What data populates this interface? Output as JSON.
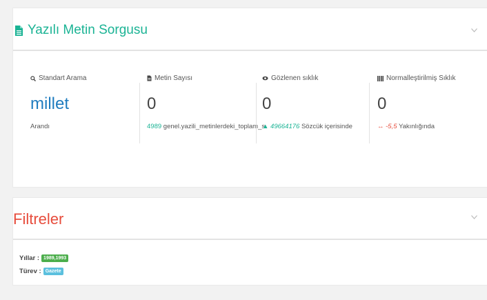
{
  "query_panel": {
    "title": "Yazılı Metin Sorgusu",
    "stats": [
      {
        "label": "Standart Arama",
        "value": "millet",
        "foot": "Arandı"
      },
      {
        "label": "Metin Sayısı",
        "value": "0",
        "foot_num": "4989",
        "foot_text": "genel.yazili_metinlerdeki_toplam_s"
      },
      {
        "label": "Gözlenen sıklık",
        "value": "0",
        "foot_num": "49664176",
        "foot_text": "Sözcük içerisinde"
      },
      {
        "label": "Normalleştirilmiş Sıklık",
        "value": "0",
        "foot_num": "-5,5",
        "foot_text": "Yakınlığında"
      }
    ]
  },
  "filters_panel": {
    "title": "Filtreler",
    "years_label": "Yıllar :",
    "years_value": "1989,1993",
    "type_label": "Türev :",
    "type_value": "Gazete"
  },
  "colors": {
    "accent": "#1ab394",
    "danger": "#e74c3c",
    "link": "#1f7cbf"
  },
  "icons": [
    "file-icon",
    "search-icon",
    "document-icon",
    "eye-icon",
    "bars-icon",
    "chevron-down-icon",
    "caret-up-icon",
    "arrows-horizontal-icon"
  ]
}
